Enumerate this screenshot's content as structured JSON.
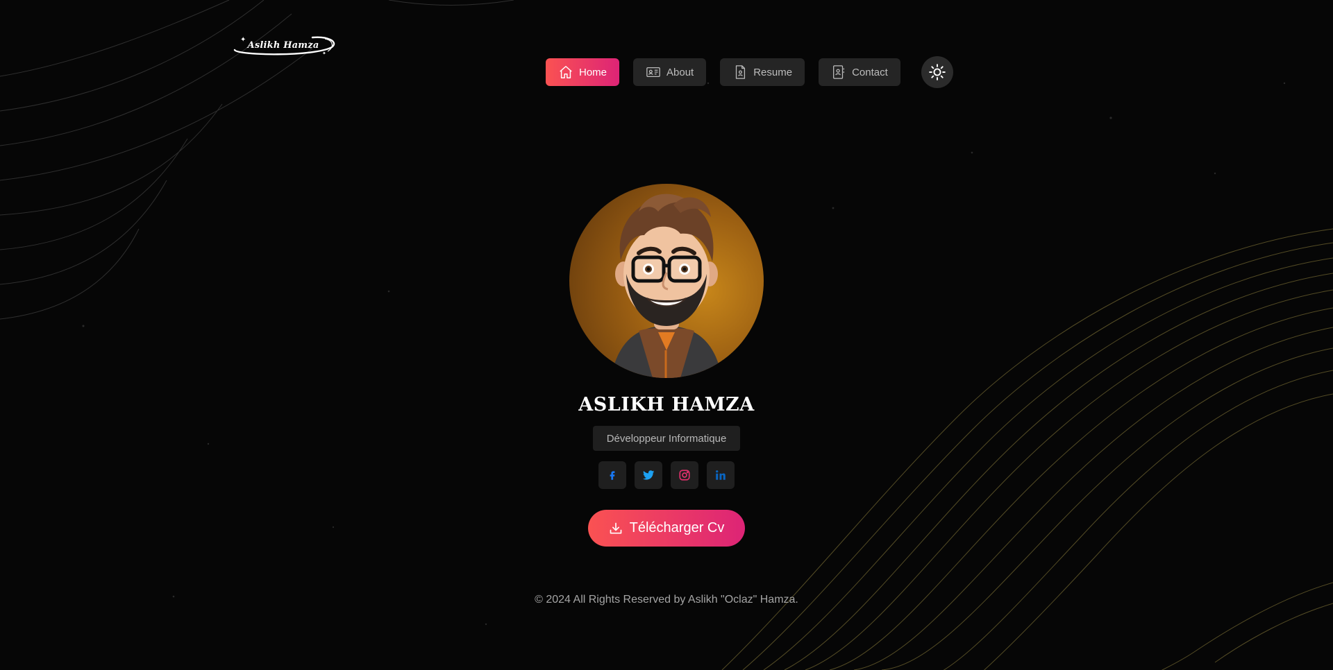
{
  "brand": {
    "logo_text": "Aslikh Hamza"
  },
  "nav": {
    "items": [
      {
        "label": "Home",
        "icon": "home-icon",
        "active": true
      },
      {
        "label": "About",
        "icon": "id-card-icon",
        "active": false
      },
      {
        "label": "Resume",
        "icon": "document-icon",
        "active": false
      },
      {
        "label": "Contact",
        "icon": "contact-card-icon",
        "active": false
      }
    ],
    "theme_toggle_icon": "sun-icon"
  },
  "profile": {
    "name": "ASLIKH HAMZA",
    "role": "Développeur Informatique",
    "avatar": "avatar-3d-illustration"
  },
  "socials": [
    {
      "icon": "facebook-icon",
      "color": "#1877f2"
    },
    {
      "icon": "twitter-icon",
      "color": "#1da1f2"
    },
    {
      "icon": "instagram-icon",
      "color": "#e1306c"
    },
    {
      "icon": "linkedin-icon",
      "color": "#0a66c2"
    }
  ],
  "cta": {
    "label": "Télécharger Cv",
    "icon": "download-icon"
  },
  "footer": {
    "text": "© 2024 All Rights Reserved by Aslikh \"Oclaz\" Hamza."
  },
  "colors": {
    "accent_start": "#fa5252",
    "accent_end": "#dd2476",
    "background": "#060606",
    "line_color": "#8a7a3a"
  }
}
